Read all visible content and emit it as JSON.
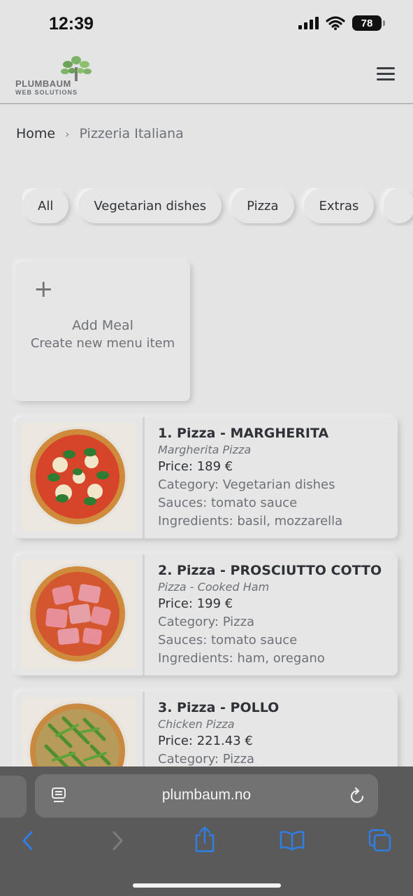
{
  "status": {
    "time": "12:39",
    "battery": "78"
  },
  "header": {
    "logo_name": "PLUMBAUM",
    "logo_sub": "WEB SOLUTIONS"
  },
  "breadcrumb": {
    "home": "Home",
    "separator": "›",
    "current": "Pizzeria Italiana"
  },
  "filters": [
    "All",
    "Vegetarian dishes",
    "Pizza",
    "Extras"
  ],
  "add_card": {
    "plus": "+",
    "title": "Add Meal",
    "subtitle": "Create new menu item"
  },
  "meals": [
    {
      "title": "1. Pizza - MARGHERITA",
      "subtitle": "Margherita Pizza",
      "price": "Price: 189 €",
      "category": "Category: Vegetarian dishes",
      "sauces": "Sauces: tomato sauce",
      "ingredients": "Ingredients: basil, mozzarella"
    },
    {
      "title": "2. Pizza - PROSCIUTTO COTTO",
      "subtitle": "Pizza - Cooked Ham",
      "price": "Price: 199 €",
      "category": "Category: Pizza",
      "sauces": "Sauces: tomato sauce",
      "ingredients": "Ingredients: ham, oregano"
    },
    {
      "title": "3. Pizza - POLLO",
      "subtitle": "Chicken Pizza",
      "price": "Price: 221.43 €",
      "category": "Category: Pizza",
      "sauces": "",
      "ingredients": ""
    }
  ],
  "browser": {
    "url": "plumbaum.no"
  },
  "colors": {
    "background": "#e4e4e4",
    "browser_bar": "#5a5a5a",
    "toolbar_accent": "#2f7ee6"
  }
}
